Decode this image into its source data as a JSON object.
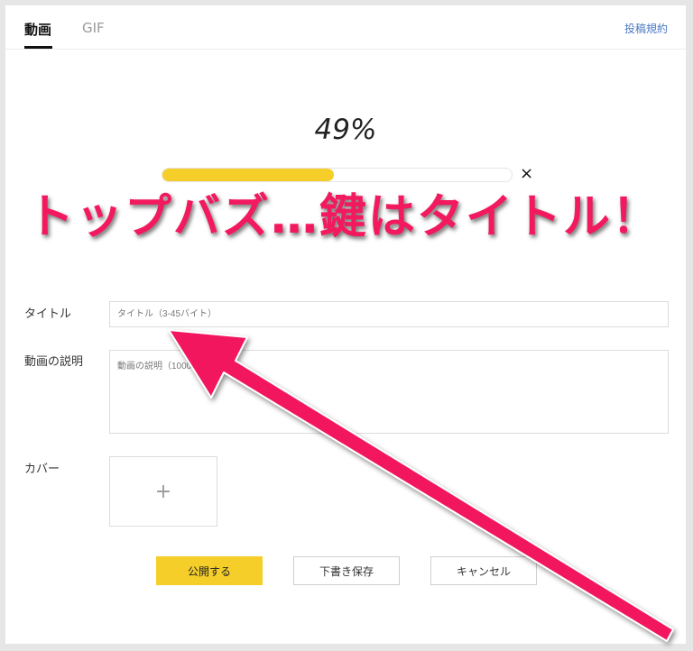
{
  "tabs": [
    {
      "label": "動画",
      "active": true
    },
    {
      "label": "GIF",
      "active": false
    }
  ],
  "header": {
    "terms_link": "投稿規約"
  },
  "upload": {
    "percent_text": "49%",
    "progress": 0.49,
    "close_icon": "×"
  },
  "overlay": {
    "caption": "トップバズ…鍵はタイトル！",
    "color": "#f2195f"
  },
  "form": {
    "title": {
      "label": "タイトル",
      "placeholder": "タイトル（3-45バイト）",
      "value": ""
    },
    "description": {
      "label": "動画の説明",
      "placeholder": "動画の説明（1000",
      "value": ""
    },
    "cover": {
      "label": "カバー",
      "add_icon": "+"
    }
  },
  "actions": {
    "publish": "公開する",
    "draft": "下書き保存",
    "cancel": "キャンセル"
  },
  "colors": {
    "accent_yellow": "#f5ce2a",
    "link_blue": "#4a78c2",
    "arrow_pink": "#f2195f"
  }
}
